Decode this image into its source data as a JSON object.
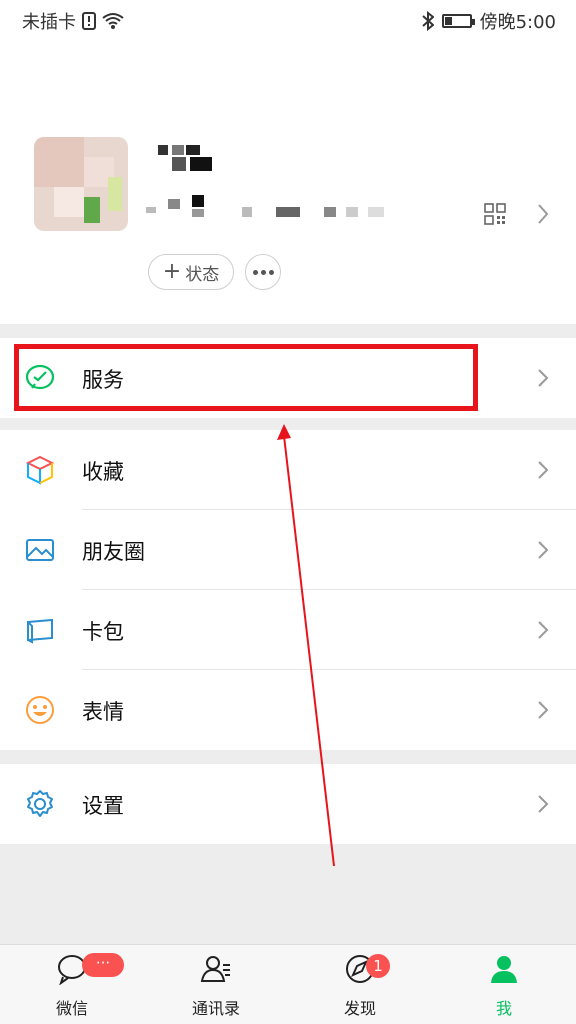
{
  "status_bar": {
    "carrier": "未插卡",
    "time": "傍晚5:00",
    "battery_level": 0.3
  },
  "profile": {
    "status_button_label": "状态",
    "status_plus": "+"
  },
  "menu": {
    "services": "服务",
    "favorites": "收藏",
    "moments": "朋友圈",
    "cards": "卡包",
    "stickers": "表情",
    "settings": "设置"
  },
  "tabbar": {
    "chats": "微信",
    "chats_badge": "···",
    "contacts": "通讯录",
    "discover": "发现",
    "discover_badge": "1",
    "me": "我"
  },
  "colors": {
    "accent": "#07c160",
    "highlight": "#e8141b",
    "badge": "#fa5151"
  }
}
